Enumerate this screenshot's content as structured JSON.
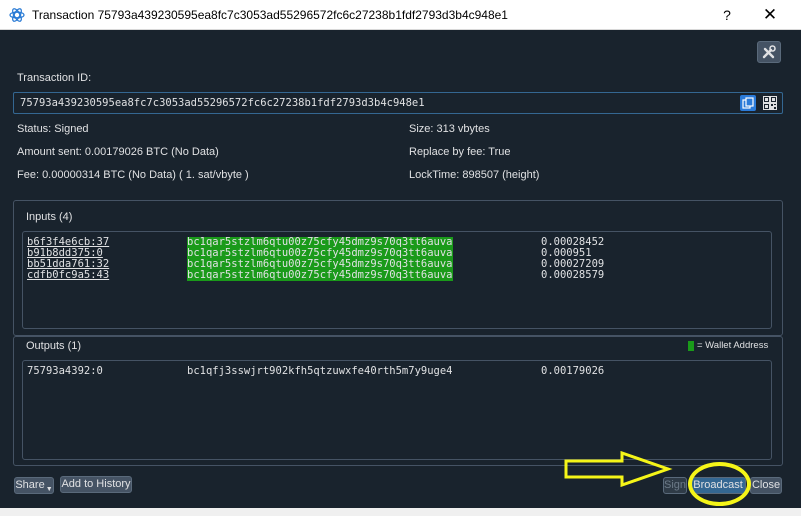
{
  "window": {
    "title": "Transaction 75793a439230595ea8fc7c3053ad55296572fc6c27238b1fdf2793d3b4c948e1",
    "help_glyph": "?",
    "close_glyph": "✕"
  },
  "txid": {
    "label": "Transaction ID:",
    "value": "75793a439230595ea8fc7c3053ad55296572fc6c27238b1fdf2793d3b4c948e1"
  },
  "details": {
    "status": "Status: Signed",
    "amount_sent": "Amount sent: 0.00179026 BTC (No Data)",
    "fee": "Fee: 0.00000314 BTC (No Data)  ( 1. sat/vbyte )",
    "size": "Size: 313 vbytes",
    "rbf": "Replace by fee: True",
    "locktime": "LockTime: 898507 (height)"
  },
  "inputs": {
    "title": "Inputs (4)",
    "rows": [
      {
        "outpoint": "b6f3f4e6cb:37",
        "address": "bc1qar5stzlm6qtu00z75cfy45dmz9s70q3tt6auva",
        "amount": "0.00028452"
      },
      {
        "outpoint": "b91b8dd375:0",
        "address": "bc1qar5stzlm6qtu00z75cfy45dmz9s70q3tt6auva",
        "amount": "0.000951"
      },
      {
        "outpoint": "bb51dda761:32",
        "address": "bc1qar5stzlm6qtu00z75cfy45dmz9s70q3tt6auva",
        "amount": "0.00027209"
      },
      {
        "outpoint": "cdfb0fc9a5:43",
        "address": "bc1qar5stzlm6qtu00z75cfy45dmz9s70q3tt6auva",
        "amount": "0.00028579"
      }
    ]
  },
  "outputs": {
    "title": "Outputs (1)",
    "rows": [
      {
        "outpoint": "75793a4392:0",
        "address": "bc1qfj3sswjrt902kfh5qtzuwxfe40rth5m7y9uge4",
        "amount": "0.00179026"
      }
    ]
  },
  "legend": {
    "label": "= Wallet Address",
    "color": "#1a9a1a"
  },
  "buttons": {
    "share": "Share",
    "add_history": "Add to History",
    "sign": "Sign",
    "broadcast": "Broadcast",
    "close": "Close"
  },
  "annotation": {
    "color": "#f5f518"
  },
  "colors": {
    "background": "#19232d",
    "panel_border": "#455364",
    "accent": "#346792"
  }
}
